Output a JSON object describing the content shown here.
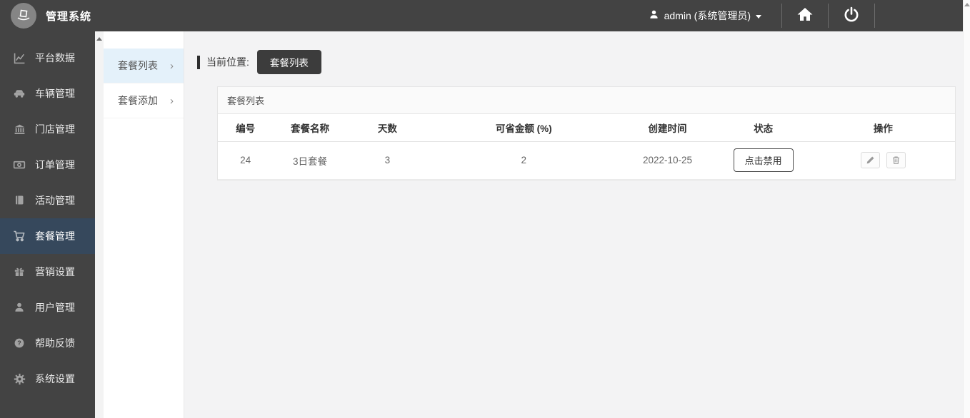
{
  "topbar": {
    "title": "管理系统",
    "user": "admin (系统管理员)"
  },
  "sidebar": {
    "items": [
      {
        "label": "平台数据",
        "icon": "chart-icon",
        "active": false
      },
      {
        "label": "车辆管理",
        "icon": "car-icon",
        "active": false
      },
      {
        "label": "门店管理",
        "icon": "store-icon",
        "active": false
      },
      {
        "label": "订单管理",
        "icon": "order-icon",
        "active": false
      },
      {
        "label": "活动管理",
        "icon": "activity-icon",
        "active": false
      },
      {
        "label": "套餐管理",
        "icon": "cart-icon",
        "active": true
      },
      {
        "label": "营销设置",
        "icon": "gift-icon",
        "active": false
      },
      {
        "label": "用户管理",
        "icon": "user-icon",
        "active": false
      },
      {
        "label": "帮助反馈",
        "icon": "help-icon",
        "active": false
      },
      {
        "label": "系统设置",
        "icon": "gear-icon",
        "active": false
      }
    ]
  },
  "submenu": {
    "items": [
      {
        "label": "套餐列表",
        "chevron": "›",
        "active": true
      },
      {
        "label": "套餐添加",
        "chevron": "›",
        "active": false
      }
    ]
  },
  "breadcrumb": {
    "label": "当前位置:",
    "current": "套餐列表"
  },
  "panel": {
    "title": "套餐列表",
    "table": {
      "columns": [
        "编号",
        "套餐名称",
        "天数",
        "可省金额 (%)",
        "创建时间",
        "状态",
        "操作"
      ],
      "rows": [
        {
          "id": "24",
          "name": "3日套餐",
          "days": "3",
          "save_percent": "2",
          "created": "2022-10-25",
          "status_button": "点击禁用"
        }
      ]
    }
  },
  "colors": {
    "topbar_bg": "#434343",
    "sidebar_active_bg": "#36485c",
    "submenu_active_bg": "#e4f1fa",
    "dark_button_bg": "#3c3c3c",
    "main_bg": "#f3f3f4"
  }
}
